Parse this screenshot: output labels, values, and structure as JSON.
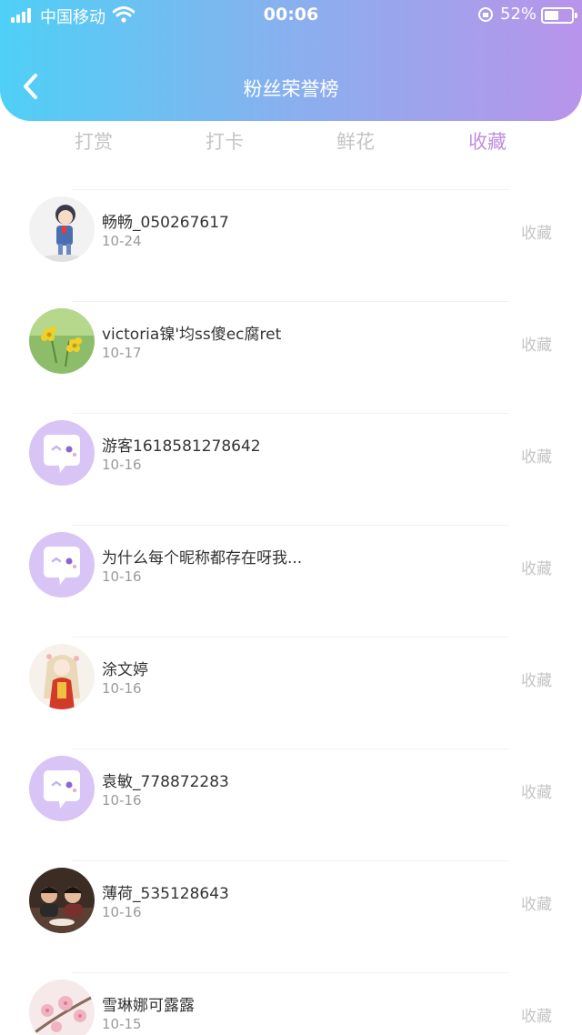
{
  "status_bar": {
    "carrier": "中国移动",
    "time": "00:06",
    "battery": "52%"
  },
  "header": {
    "title": "粉丝荣誉榜"
  },
  "tabs": [
    {
      "label": "打赏",
      "active": false
    },
    {
      "label": "打卡",
      "active": false
    },
    {
      "label": "鲜花",
      "active": false
    },
    {
      "label": "收藏",
      "active": true
    }
  ],
  "fans": [
    {
      "name": "畅畅_050267617",
      "date": "10-24",
      "action": "收藏",
      "avatar": "cartoon-boy"
    },
    {
      "name": "victoria镍'均ss傻ec腐ret",
      "date": "10-17",
      "action": "收藏",
      "avatar": "flowers"
    },
    {
      "name": "游客1618581278642",
      "date": "10-16",
      "action": "收藏",
      "avatar": "default-chat"
    },
    {
      "name": "为什么每个昵称都存在呀我...",
      "date": "10-16",
      "action": "收藏",
      "avatar": "default-chat"
    },
    {
      "name": "涂文婷",
      "date": "10-16",
      "action": "收藏",
      "avatar": "anime-girl"
    },
    {
      "name": "袁敏_778872283",
      "date": "10-16",
      "action": "收藏",
      "avatar": "default-chat"
    },
    {
      "name": "薄荷_535128643",
      "date": "10-16",
      "action": "收藏",
      "avatar": "group-photo"
    },
    {
      "name": "雪琳娜可露露",
      "date": "10-15",
      "action": "收藏",
      "avatar": "blossom"
    }
  ],
  "colors": {
    "gradient_start": "#4fd0f6",
    "gradient_end": "#b894ea",
    "active_tab": "#c08ee4",
    "default_avatar": "#d9c4f6"
  }
}
